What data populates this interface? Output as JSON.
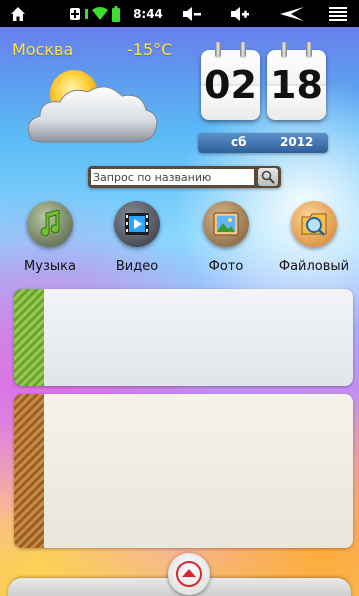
{
  "status_bar": {
    "time": "8:44",
    "icons": [
      "home-icon",
      "usb-icon",
      "wifi-icon",
      "battery-icon",
      "volume-down-icon",
      "volume-up-icon",
      "back-icon",
      "menu-icon"
    ]
  },
  "weather": {
    "city": "Москва",
    "temperature": "-15°C",
    "icon": "partly-cloudy-icon"
  },
  "clock": {
    "hours": "02",
    "minutes": "18",
    "weekday": "сб",
    "year": "2012"
  },
  "search": {
    "placeholder": "Запрос по названию"
  },
  "apps": [
    {
      "label": "Музыка",
      "icon": "music-icon"
    },
    {
      "label": "Видео",
      "icon": "video-icon"
    },
    {
      "label": "Фото",
      "icon": "photo-icon"
    },
    {
      "label": "Файловый",
      "icon": "file-manager-icon"
    }
  ],
  "colors": {
    "city_text": "#ffe33b",
    "panel1_stripe": "#7cb33a",
    "panel2_stripe": "#b5722e"
  }
}
